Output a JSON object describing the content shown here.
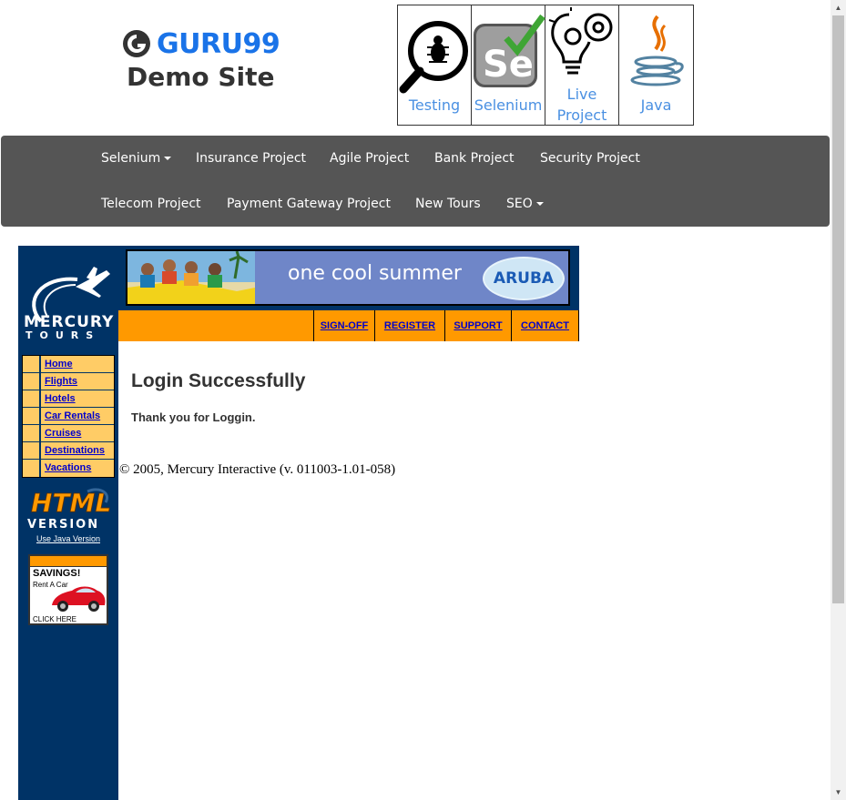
{
  "header": {
    "brand": "GURU99",
    "subtitle": "Demo Site"
  },
  "tiles": [
    {
      "caption": "Testing",
      "icon": "magnifier-bug-icon"
    },
    {
      "caption": "Selenium",
      "icon": "selenium-icon"
    },
    {
      "caption_line1": "Live",
      "caption_line2": "Project",
      "icon": "lightbulb-gear-icon"
    },
    {
      "caption": "Java",
      "icon": "java-icon"
    }
  ],
  "navbar": {
    "row1": [
      "Selenium",
      "Insurance Project",
      "Agile Project",
      "Bank Project",
      "Security Project"
    ],
    "row2": [
      "Telecom Project",
      "Payment Gateway Project",
      "New Tours",
      "SEO"
    ]
  },
  "mercury": {
    "logo_word1": "MERCURY",
    "logo_word2": "TOURS",
    "menu": [
      "Home",
      "Flights",
      "Hotels",
      "Car Rentals",
      "Cruises",
      "Destinations",
      "Vacations"
    ],
    "html_version_line1": "HTML",
    "html_version_line2": "VERSION",
    "java_link": "Use Java Version",
    "ad": {
      "headline": "SAVINGS!",
      "sub": "Rent A Car",
      "cta": "CLICK HERE"
    }
  },
  "banner": {
    "text": "one cool summer",
    "badge": "ARUBA"
  },
  "topnav": [
    "SIGN-OFF",
    "REGISTER",
    "SUPPORT",
    "CONTACT"
  ],
  "content": {
    "title": "Login Successfully",
    "message": "Thank you for Loggin.",
    "copyright": "© 2005, Mercury Interactive (v. 011003-1.01-058)"
  },
  "colors": {
    "navbar_bg": "#555555",
    "mercury_blue": "#003366",
    "orange": "#ff9900",
    "menu_yellow": "#ffcc66",
    "link_blue": "#0000cc",
    "guru_blue": "#1a73e8"
  }
}
